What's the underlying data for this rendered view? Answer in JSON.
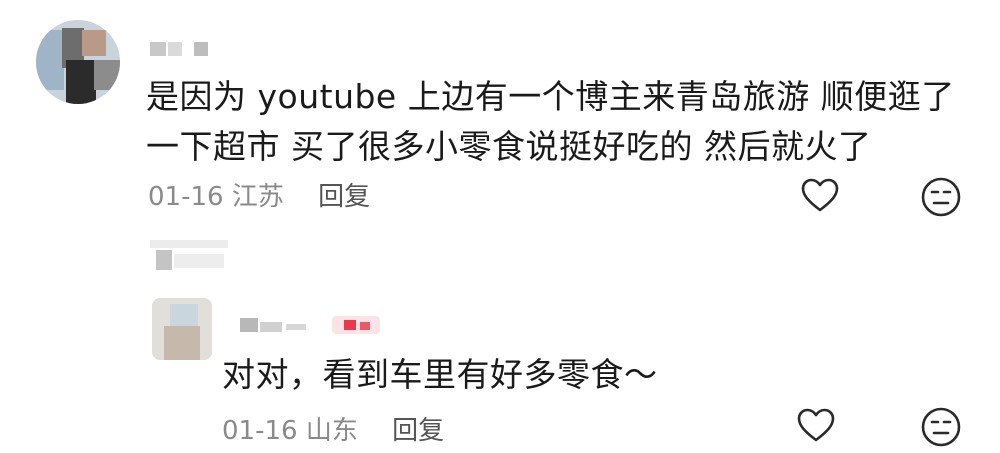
{
  "comment": {
    "text": "是因为 youtube 上边有一个博主来青岛旅游 顺便逛了一下超市 买了很多小零食说挺好吃的 然后就火了",
    "date": "01-16",
    "location": "江苏",
    "reply_label": "回复",
    "icons": {
      "like": "heart-outline-icon",
      "react": "neutral-face-icon"
    }
  },
  "reply": {
    "text": "对对，看到车里有好多零食～",
    "date": "01-16",
    "location": "山东",
    "reply_label": "回复",
    "icons": {
      "like": "heart-outline-icon",
      "react": "neutral-face-icon"
    }
  }
}
